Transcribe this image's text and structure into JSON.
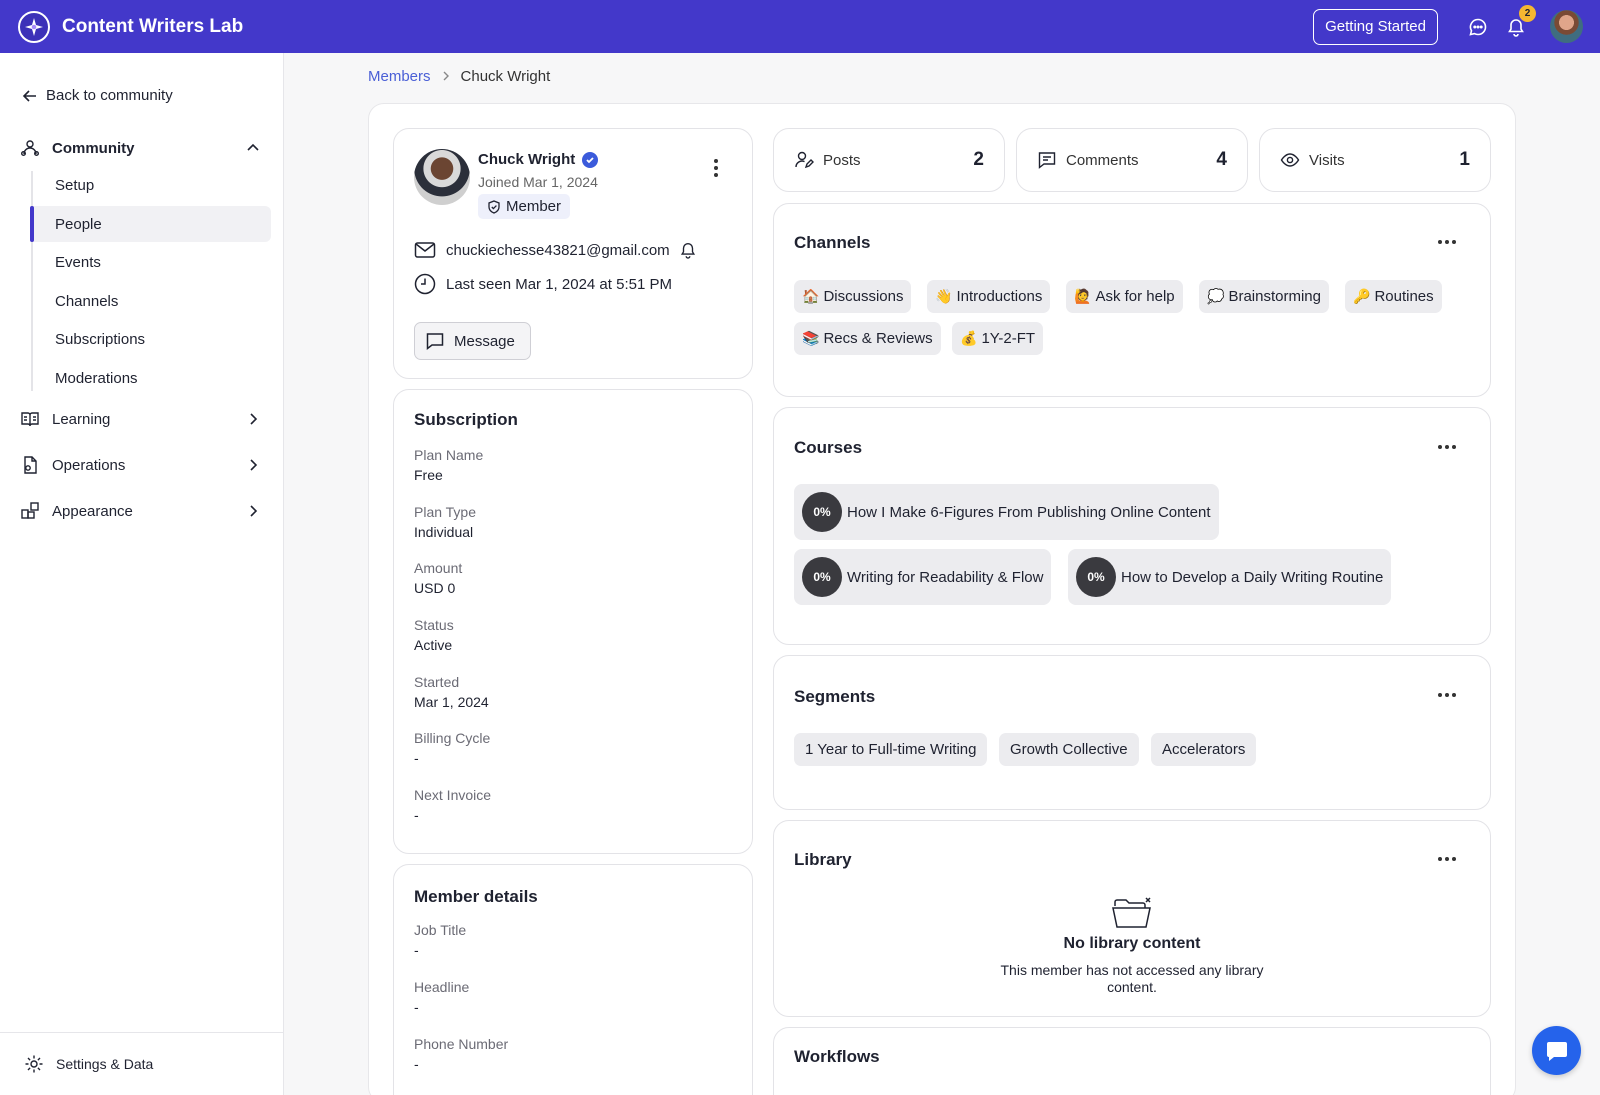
{
  "app": {
    "name": "Content Writers Lab"
  },
  "topbar": {
    "getting_started": "Getting Started",
    "notification_count": "2"
  },
  "sidebar": {
    "back_label": "Back to community",
    "community_label": "Community",
    "community_items": [
      {
        "label": "Setup"
      },
      {
        "label": "People"
      },
      {
        "label": "Events"
      },
      {
        "label": "Channels"
      },
      {
        "label": "Subscriptions"
      },
      {
        "label": "Moderations"
      }
    ],
    "groups": [
      {
        "label": "Learning"
      },
      {
        "label": "Operations"
      },
      {
        "label": "Appearance"
      }
    ],
    "settings_label": "Settings & Data"
  },
  "breadcrumb": {
    "parent": "Members",
    "current": "Chuck Wright"
  },
  "profile": {
    "name": "Chuck Wright",
    "joined": "Joined Mar 1, 2024",
    "role": "Member",
    "email": "chuckiechesse43821@gmail.com",
    "last_seen": "Last seen Mar 1, 2024 at 5:51 PM",
    "message_label": "Message"
  },
  "subscription": {
    "title": "Subscription",
    "fields": [
      {
        "key": "Plan Name",
        "value": "Free"
      },
      {
        "key": "Plan Type",
        "value": "Individual"
      },
      {
        "key": "Amount",
        "value": "USD 0"
      },
      {
        "key": "Status",
        "value": "Active"
      },
      {
        "key": "Started",
        "value": "Mar 1, 2024"
      },
      {
        "key": "Billing Cycle",
        "value": "-"
      },
      {
        "key": "Next Invoice",
        "value": "-"
      }
    ]
  },
  "member_details": {
    "title": "Member details",
    "fields": [
      {
        "key": "Job Title",
        "value": "-"
      },
      {
        "key": "Headline",
        "value": "-"
      },
      {
        "key": "Phone Number",
        "value": "-"
      }
    ]
  },
  "stats": [
    {
      "label": "Posts",
      "value": "2",
      "icon": "user-edit-icon"
    },
    {
      "label": "Comments",
      "value": "4",
      "icon": "comment-icon"
    },
    {
      "label": "Visits",
      "value": "1",
      "icon": "eye-icon"
    }
  ],
  "channels": {
    "title": "Channels",
    "items": [
      {
        "emoji": "🏠",
        "label": "Discussions"
      },
      {
        "emoji": "👋",
        "label": "Introductions"
      },
      {
        "emoji": "🙋",
        "label": "Ask for help"
      },
      {
        "emoji": "💭",
        "label": "Brainstorming"
      },
      {
        "emoji": "🔑",
        "label": "Routines"
      },
      {
        "emoji": "📚",
        "label": "Recs & Reviews"
      },
      {
        "emoji": "💰",
        "label": "1Y-2-FT"
      }
    ]
  },
  "courses": {
    "title": "Courses",
    "items": [
      {
        "progress": "0%",
        "label": "How I Make 6-Figures From Publishing Online Content"
      },
      {
        "progress": "0%",
        "label": "Writing for Readability & Flow"
      },
      {
        "progress": "0%",
        "label": "How to Develop a Daily Writing Routine"
      }
    ]
  },
  "segments": {
    "title": "Segments",
    "items": [
      {
        "label": "1 Year to Full-time Writing"
      },
      {
        "label": "Growth Collective"
      },
      {
        "label": "Accelerators"
      }
    ]
  },
  "library": {
    "title": "Library",
    "empty_title": "No library content",
    "empty_text_line1": "This member has not accessed any library",
    "empty_text_line2": "content."
  },
  "workflows": {
    "title": "Workflows"
  },
  "colors": {
    "brand": "#4338ca",
    "accent": "#3b5bdb",
    "badge": "#f5b731",
    "fab": "#2563eb"
  }
}
